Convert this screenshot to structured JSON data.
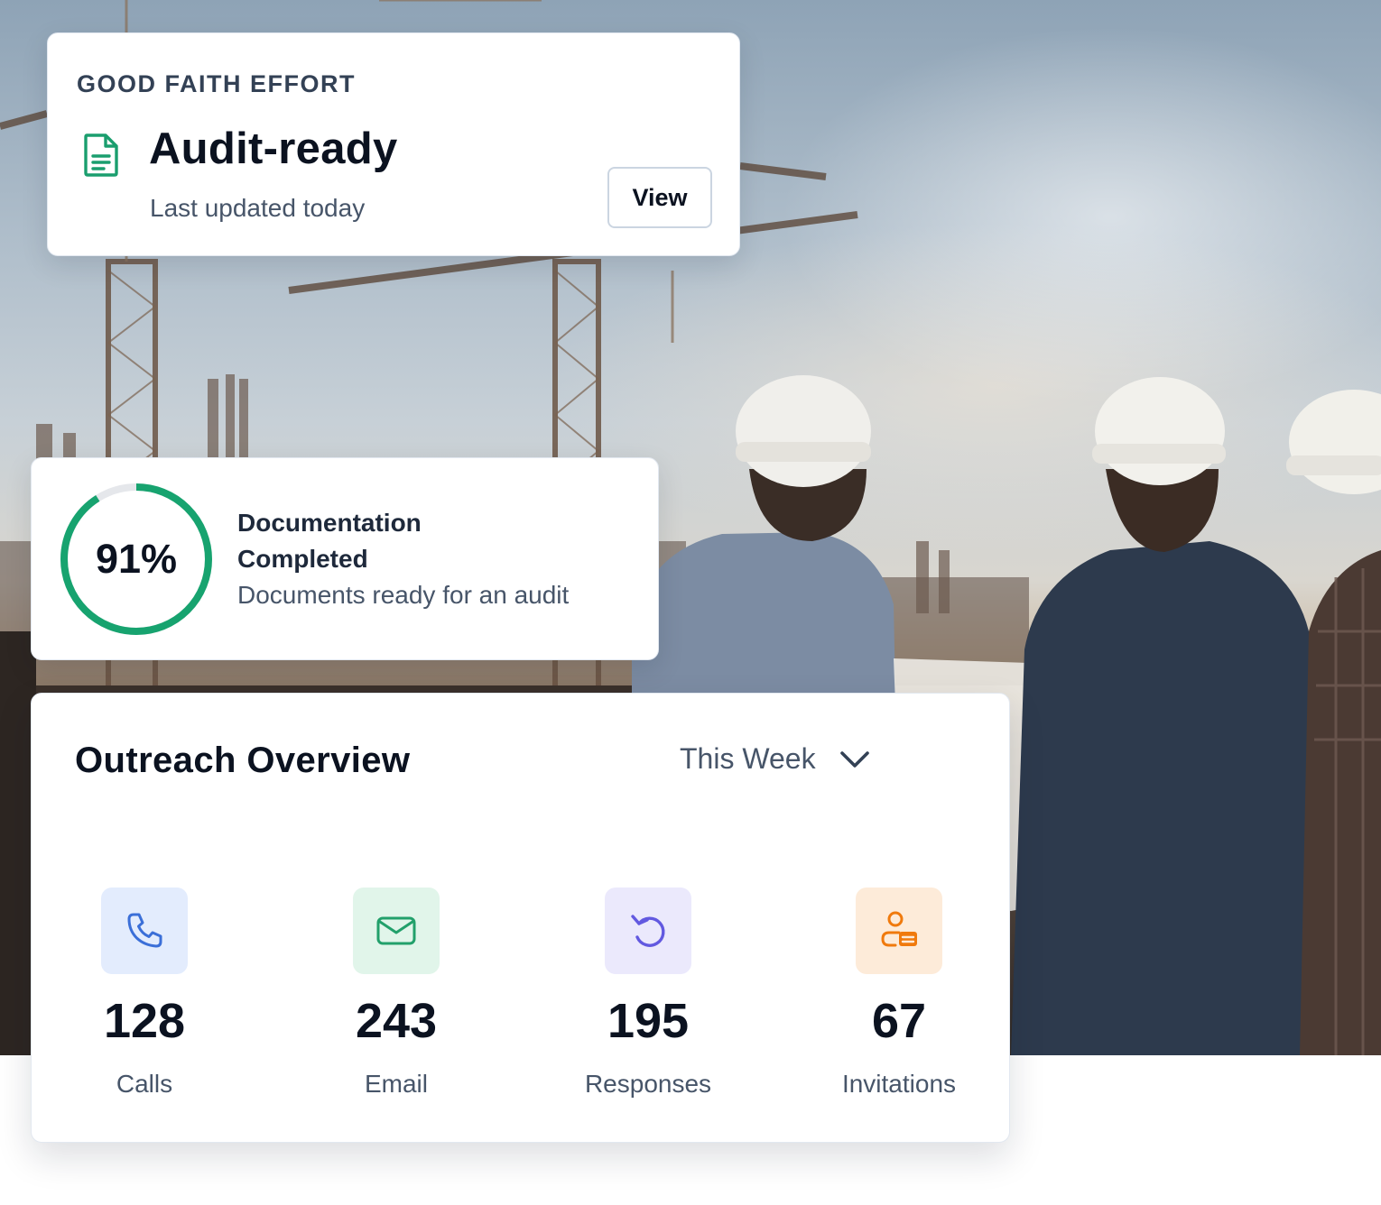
{
  "good_faith_card": {
    "eyebrow": "GOOD FAITH EFFORT",
    "title": "Audit-ready",
    "subtitle": "Last updated today",
    "view_label": "View",
    "icon": "document-icon",
    "accent": "#1a9e6e"
  },
  "documentation_card": {
    "percent_label": "91%",
    "progress": 0.91,
    "heading": "Documentation Completed",
    "description": "Documents ready for an audit",
    "ring_color": "#17a36f",
    "track_color": "#e5e7eb"
  },
  "outreach_card": {
    "title": "Outreach Overview",
    "period": "This Week",
    "stats": [
      {
        "value": "128",
        "label": "Calls",
        "icon": "phone-icon",
        "tile_color": "#e3ecfd",
        "icon_color": "#3b6fd8"
      },
      {
        "value": "243",
        "label": "Email",
        "icon": "mail-icon",
        "tile_color": "#e1f5ea",
        "icon_color": "#22a06b"
      },
      {
        "value": "195",
        "label": "Responses",
        "icon": "reply-icon",
        "tile_color": "#ebe9fc",
        "icon_color": "#6259e0"
      },
      {
        "value": "67",
        "label": "Invitations",
        "icon": "invite-icon",
        "tile_color": "#fdebd9",
        "icon_color": "#f07a0d"
      }
    ]
  }
}
